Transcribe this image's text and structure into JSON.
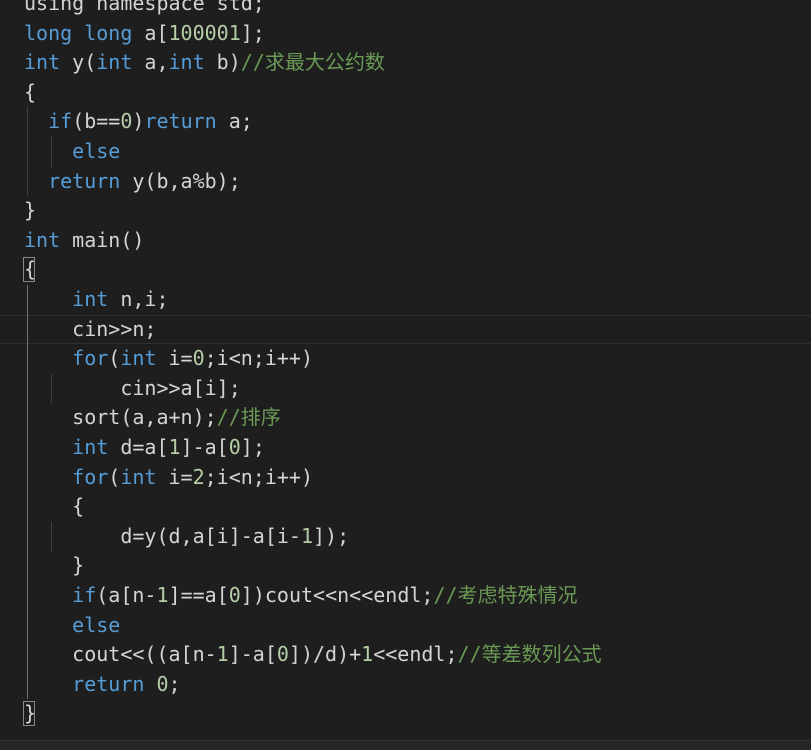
{
  "theme": {
    "background": "#1e1e1e",
    "default": "#d4d4d4",
    "keyword": "#569cd6",
    "control": "#569cd6",
    "number": "#b5cea8",
    "comment": "#6a9955",
    "guide": "#404040"
  },
  "lines": [
    {
      "indent": 0,
      "tokens": [
        {
          "t": "using namespace std;",
          "c": "default"
        }
      ]
    },
    {
      "indent": 0,
      "tokens": [
        {
          "t": "long long",
          "c": "keyword"
        },
        {
          "t": " a[",
          "c": "default"
        },
        {
          "t": "100001",
          "c": "number"
        },
        {
          "t": "];",
          "c": "default"
        }
      ]
    },
    {
      "indent": 0,
      "tokens": [
        {
          "t": "int",
          "c": "keyword"
        },
        {
          "t": " y(",
          "c": "default"
        },
        {
          "t": "int",
          "c": "keyword"
        },
        {
          "t": " a,",
          "c": "default"
        },
        {
          "t": "int",
          "c": "keyword"
        },
        {
          "t": " b)",
          "c": "default"
        },
        {
          "t": "//求最大公约数",
          "c": "comment"
        }
      ]
    },
    {
      "indent": 0,
      "tokens": [
        {
          "t": "{",
          "c": "default"
        }
      ]
    },
    {
      "indent": 1,
      "tokens": [
        {
          "t": "  ",
          "c": "default"
        },
        {
          "t": "if",
          "c": "control"
        },
        {
          "t": "(b==",
          "c": "default"
        },
        {
          "t": "0",
          "c": "number"
        },
        {
          "t": ")",
          "c": "default"
        },
        {
          "t": "return",
          "c": "control"
        },
        {
          "t": " a;",
          "c": "default"
        }
      ]
    },
    {
      "indent": 2,
      "tokens": [
        {
          "t": "    ",
          "c": "default"
        },
        {
          "t": "else",
          "c": "control"
        }
      ]
    },
    {
      "indent": 1,
      "tokens": [
        {
          "t": "  ",
          "c": "default"
        },
        {
          "t": "return",
          "c": "control"
        },
        {
          "t": " y(b,a%b);",
          "c": "default"
        }
      ]
    },
    {
      "indent": 0,
      "tokens": [
        {
          "t": "}",
          "c": "default"
        }
      ]
    },
    {
      "indent": 0,
      "tokens": [
        {
          "t": "int",
          "c": "keyword"
        },
        {
          "t": " main()",
          "c": "default"
        }
      ]
    },
    {
      "indent": 0,
      "bracket": true,
      "tokens": [
        {
          "t": "{",
          "c": "default"
        }
      ]
    },
    {
      "indent": 1,
      "tokens": [
        {
          "t": "    ",
          "c": "default"
        },
        {
          "t": "int",
          "c": "keyword"
        },
        {
          "t": " n,i;",
          "c": "default"
        }
      ]
    },
    {
      "indent": 1,
      "current": true,
      "tokens": [
        {
          "t": "    cin>>n;",
          "c": "default"
        }
      ]
    },
    {
      "indent": 1,
      "tokens": [
        {
          "t": "    ",
          "c": "default"
        },
        {
          "t": "for",
          "c": "control"
        },
        {
          "t": "(",
          "c": "default"
        },
        {
          "t": "int",
          "c": "keyword"
        },
        {
          "t": " i=",
          "c": "default"
        },
        {
          "t": "0",
          "c": "number"
        },
        {
          "t": ";i<n;i++)",
          "c": "default"
        }
      ]
    },
    {
      "indent": 2,
      "tokens": [
        {
          "t": "        cin>>a[i];",
          "c": "default"
        }
      ]
    },
    {
      "indent": 1,
      "tokens": [
        {
          "t": "    sort(a,a+n);",
          "c": "default"
        },
        {
          "t": "//排序",
          "c": "comment"
        }
      ]
    },
    {
      "indent": 1,
      "tokens": [
        {
          "t": "    ",
          "c": "default"
        },
        {
          "t": "int",
          "c": "keyword"
        },
        {
          "t": " d=a[",
          "c": "default"
        },
        {
          "t": "1",
          "c": "number"
        },
        {
          "t": "]-a[",
          "c": "default"
        },
        {
          "t": "0",
          "c": "number"
        },
        {
          "t": "];",
          "c": "default"
        }
      ]
    },
    {
      "indent": 1,
      "tokens": [
        {
          "t": "    ",
          "c": "default"
        },
        {
          "t": "for",
          "c": "control"
        },
        {
          "t": "(",
          "c": "default"
        },
        {
          "t": "int",
          "c": "keyword"
        },
        {
          "t": " i=",
          "c": "default"
        },
        {
          "t": "2",
          "c": "number"
        },
        {
          "t": ";i<n;i++)",
          "c": "default"
        }
      ]
    },
    {
      "indent": 1,
      "tokens": [
        {
          "t": "    {",
          "c": "default"
        }
      ]
    },
    {
      "indent": 2,
      "tokens": [
        {
          "t": "        d=y(d,a[i]-a[i-",
          "c": "default"
        },
        {
          "t": "1",
          "c": "number"
        },
        {
          "t": "]);",
          "c": "default"
        }
      ]
    },
    {
      "indent": 1,
      "tokens": [
        {
          "t": "    }",
          "c": "default"
        }
      ]
    },
    {
      "indent": 1,
      "tokens": [
        {
          "t": "    ",
          "c": "default"
        },
        {
          "t": "if",
          "c": "control"
        },
        {
          "t": "(a[n-",
          "c": "default"
        },
        {
          "t": "1",
          "c": "number"
        },
        {
          "t": "]==a[",
          "c": "default"
        },
        {
          "t": "0",
          "c": "number"
        },
        {
          "t": "])cout<<n<<endl;",
          "c": "default"
        },
        {
          "t": "//考虑特殊情况",
          "c": "comment"
        }
      ]
    },
    {
      "indent": 1,
      "tokens": [
        {
          "t": "    ",
          "c": "default"
        },
        {
          "t": "else",
          "c": "control"
        }
      ]
    },
    {
      "indent": 1,
      "tokens": [
        {
          "t": "    cout<<((a[n-",
          "c": "default"
        },
        {
          "t": "1",
          "c": "number"
        },
        {
          "t": "]-a[",
          "c": "default"
        },
        {
          "t": "0",
          "c": "number"
        },
        {
          "t": "])/d)+",
          "c": "default"
        },
        {
          "t": "1",
          "c": "number"
        },
        {
          "t": "<<endl;",
          "c": "default"
        },
        {
          "t": "//等差数列公式",
          "c": "comment"
        }
      ]
    },
    {
      "indent": 1,
      "tokens": [
        {
          "t": "    ",
          "c": "default"
        },
        {
          "t": "return",
          "c": "control"
        },
        {
          "t": " ",
          "c": "default"
        },
        {
          "t": "0",
          "c": "number"
        },
        {
          "t": ";",
          "c": "default"
        }
      ]
    },
    {
      "indent": 0,
      "bracket": true,
      "tokens": [
        {
          "t": "}",
          "c": "default"
        }
      ]
    }
  ]
}
